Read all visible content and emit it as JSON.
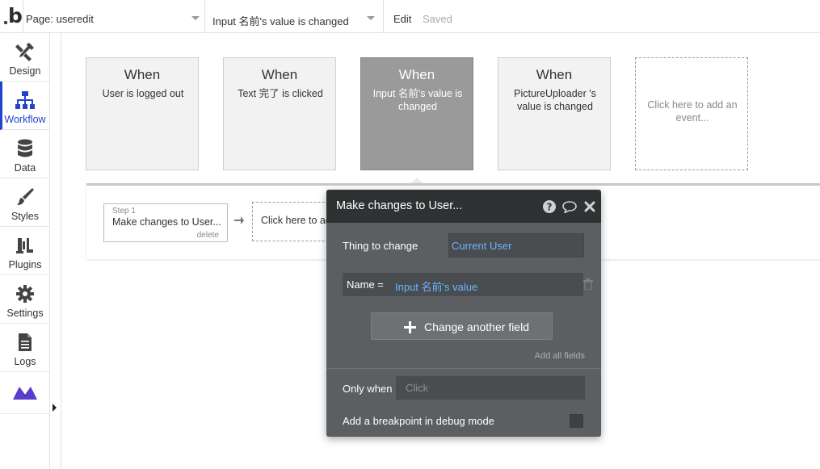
{
  "topbar": {
    "logo": "b",
    "page_select": "Page: useredit",
    "event_select": "Input 名前's value is changed",
    "edit": "Edit",
    "saved": "Saved"
  },
  "sidebar": {
    "items": [
      {
        "label": "Design",
        "icon": "design-tools-icon"
      },
      {
        "label": "Workflow",
        "icon": "workflow-icon"
      },
      {
        "label": "Data",
        "icon": "database-icon"
      },
      {
        "label": "Styles",
        "icon": "brush-icon"
      },
      {
        "label": "Plugins",
        "icon": "plug-icon"
      },
      {
        "label": "Settings",
        "icon": "gear-icon"
      },
      {
        "label": "Logs",
        "icon": "document-icon"
      },
      {
        "label": "",
        "icon": "mountains-logo-icon"
      }
    ],
    "active": "Workflow",
    "accent_color": "#2244cc"
  },
  "events": [
    {
      "when": "When",
      "desc": "User is logged out"
    },
    {
      "when": "When",
      "desc": "Text 完了 is clicked"
    },
    {
      "when": "When",
      "desc": "Input 名前's value is changed"
    },
    {
      "when": "When",
      "desc": "PictureUploader 's value is changed"
    }
  ],
  "add_event": "Click here to add an event...",
  "step": {
    "num": "Step 1",
    "name": "Make changes to User...",
    "delete": "delete"
  },
  "add_action": "Click here to add an action...",
  "popup": {
    "title": "Make changes to User...",
    "thing_label": "Thing to change",
    "thing_value": "Current User",
    "field_name": "Name  =",
    "field_value": "Input 名前's value",
    "change_button": "Change another field",
    "add_all": "Add all fields",
    "only_when_label": "Only when",
    "only_when_placeholder": "Click",
    "breakpoint_label": "Add a breakpoint in debug mode",
    "link_color": "#69b4ff"
  }
}
